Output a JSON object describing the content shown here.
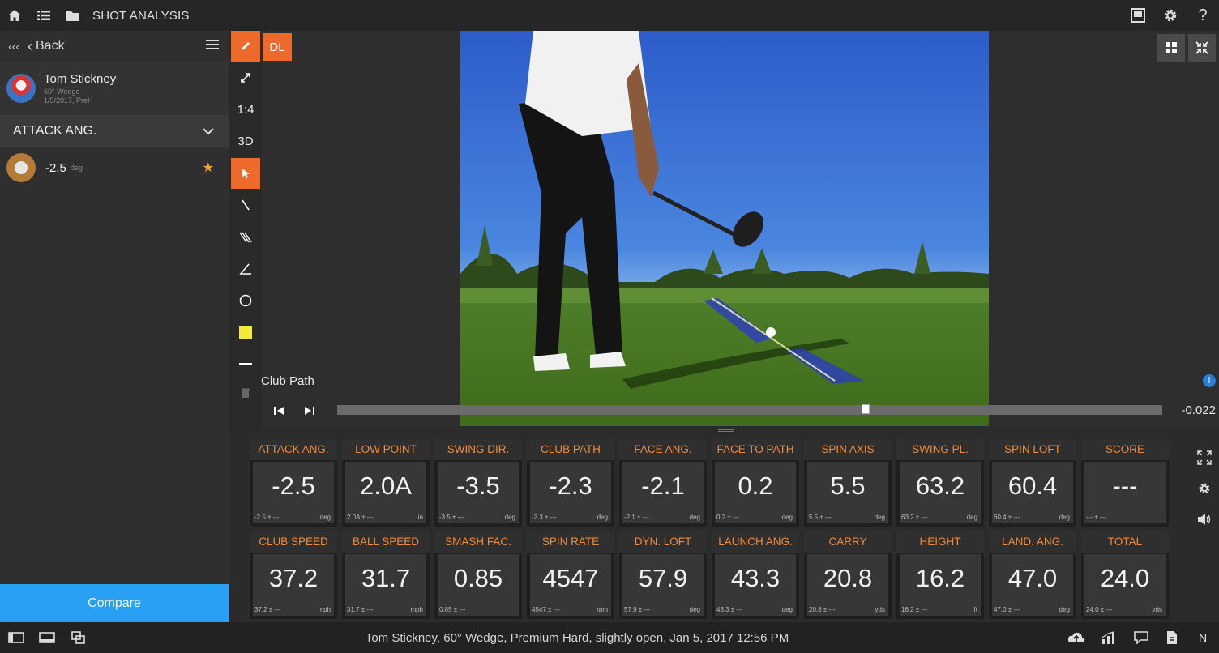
{
  "app": {
    "title": "SHOT ANALYSIS"
  },
  "left_panel": {
    "back_label": "Back",
    "player_name": "Tom Stickney",
    "player_club": "60° Wedge",
    "player_date": "1/5/2017, PreH",
    "metric_selected": "ATTACK ANG.",
    "shot_value": "-2.5",
    "shot_unit": "deg",
    "compare_label": "Compare"
  },
  "toolbar": {
    "ratio_label": "1:4",
    "threed_label": "3D",
    "dl_label": "DL",
    "active_tool": "pointer"
  },
  "video": {
    "overlay_label": "Club Path",
    "time_value": "-0.022",
    "scrub_progress": 0.64
  },
  "tiles": [
    {
      "label": "ATTACK ANG.",
      "value": "-2.5",
      "sub": "-2.5 ± ---",
      "unit": "deg"
    },
    {
      "label": "LOW POINT",
      "value": "2.0A",
      "sub": "2.0A ± ---",
      "unit": "in"
    },
    {
      "label": "SWING DIR.",
      "value": "-3.5",
      "sub": "-3.5 ± ---",
      "unit": "deg"
    },
    {
      "label": "CLUB PATH",
      "value": "-2.3",
      "sub": "-2.3 ± ---",
      "unit": "deg"
    },
    {
      "label": "FACE ANG.",
      "value": "-2.1",
      "sub": "-2.1 ± ---",
      "unit": "deg"
    },
    {
      "label": "FACE TO PATH",
      "value": "0.2",
      "sub": "0.2 ± ---",
      "unit": "deg"
    },
    {
      "label": "SPIN AXIS",
      "value": "5.5",
      "sub": "5.5 ± ---",
      "unit": "deg"
    },
    {
      "label": "SWING PL.",
      "value": "63.2",
      "sub": "63.2 ± ---",
      "unit": "deg"
    },
    {
      "label": "SPIN LOFT",
      "value": "60.4",
      "sub": "60.4 ± ---",
      "unit": "deg"
    },
    {
      "label": "SCORE",
      "value": "---",
      "sub": "--- ± ---",
      "unit": ""
    },
    {
      "label": "CLUB SPEED",
      "value": "37.2",
      "sub": "37.2 ± ---",
      "unit": "mph"
    },
    {
      "label": "BALL SPEED",
      "value": "31.7",
      "sub": "31.7 ± ---",
      "unit": "mph"
    },
    {
      "label": "SMASH FAC.",
      "value": "0.85",
      "sub": "0.85 ± ---",
      "unit": ""
    },
    {
      "label": "SPIN RATE",
      "value": "4547",
      "sub": "4547 ± ---",
      "unit": "rpm"
    },
    {
      "label": "DYN. LOFT",
      "value": "57.9",
      "sub": "57.9 ± ---",
      "unit": "deg"
    },
    {
      "label": "LAUNCH ANG.",
      "value": "43.3",
      "sub": "43.3 ± ---",
      "unit": "deg"
    },
    {
      "label": "CARRY",
      "value": "20.8",
      "sub": "20.8 ± ---",
      "unit": "yds"
    },
    {
      "label": "HEIGHT",
      "value": "16.2",
      "sub": "16.2 ± ---",
      "unit": "ft"
    },
    {
      "label": "LAND. ANG.",
      "value": "47.0",
      "sub": "47.0 ± ---",
      "unit": "deg"
    },
    {
      "label": "TOTAL",
      "value": "24.0",
      "sub": "24.0 ± ---",
      "unit": "yds"
    }
  ],
  "status_bar": {
    "text": "Tom Stickney, 60° Wedge, Premium Hard, slightly open, Jan 5, 2017 12:56 PM",
    "n_label": "N"
  },
  "colors": {
    "accent_orange": "#ee6a2a",
    "label_orange": "#f08a3c",
    "compare_blue": "#2aa0f4"
  }
}
